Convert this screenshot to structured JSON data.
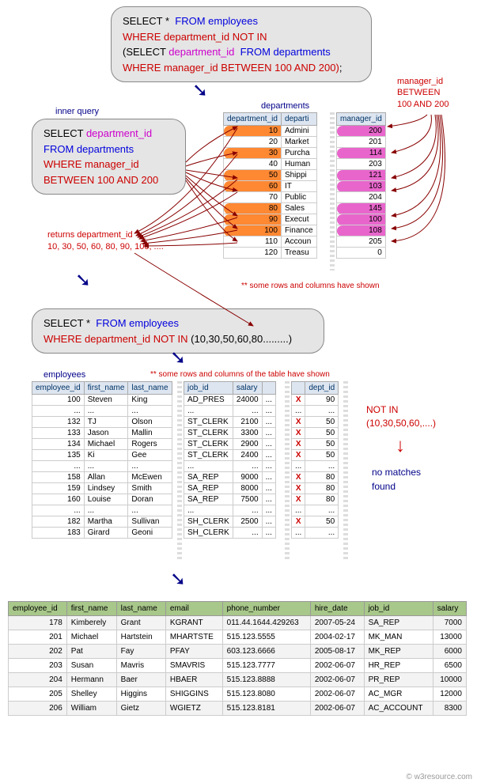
{
  "queries": {
    "main": {
      "l1a": "SELECT * ",
      "l1b": "FROM employees",
      "l2a": "WHERE department_id NOT IN",
      "l3a": "(SELECT ",
      "l3b": "department_id ",
      "l3c": "FROM departments",
      "l4a": "WHERE manager_id BETWEEN 100 AND 200)",
      "l4b": ";"
    },
    "inner": {
      "l1a": "SELECT ",
      "l1b": "department_id",
      "l2": "FROM departments",
      "l3a": "WHERE manager_id",
      "l3b": "BETWEEN 100 AND 200"
    },
    "expanded": {
      "l1a": "SELECT * ",
      "l1b": "FROM employees",
      "l2a": "WHERE department_id NOT IN ",
      "l2b": "(10,30,50,60,80.........)"
    }
  },
  "labels": {
    "inner_query": "inner query",
    "departments": "departments",
    "mgr_between": "manager_id\nBETWEEN\n100 AND 200",
    "returns": "returns department_id\n10, 30, 50, 60, 80, 90, 100, ....",
    "note1": "** some rows and columns have shown",
    "employees": "employees",
    "note2": "** some rows and columns of the table have shown",
    "notin": "NOT IN\n(10,30,50,60,....)",
    "nomatch": "no matches\nfound",
    "footer": "© w3resource.com"
  },
  "dept_table": {
    "headers": [
      "department_id",
      "departi",
      "manager_id"
    ],
    "rows": [
      {
        "id": "10",
        "name": "Admini",
        "mgr": "200",
        "hl": true
      },
      {
        "id": "20",
        "name": "Market",
        "mgr": "201",
        "hl": false
      },
      {
        "id": "30",
        "name": "Purcha",
        "mgr": "114",
        "hl": true
      },
      {
        "id": "40",
        "name": "Human",
        "mgr": "203",
        "hl": false
      },
      {
        "id": "50",
        "name": "Shippi",
        "mgr": "121",
        "hl": true
      },
      {
        "id": "60",
        "name": "IT",
        "mgr": "103",
        "hl": true
      },
      {
        "id": "70",
        "name": "Public",
        "mgr": "204",
        "hl": false
      },
      {
        "id": "80",
        "name": "Sales",
        "mgr": "145",
        "hl": true
      },
      {
        "id": "90",
        "name": "Execut",
        "mgr": "100",
        "hl": true
      },
      {
        "id": "100",
        "name": "Finance",
        "mgr": "108",
        "hl": true
      },
      {
        "id": "110",
        "name": "Accoun",
        "mgr": "205",
        "hl": false
      },
      {
        "id": "120",
        "name": "Treasu",
        "mgr": "0",
        "hl": false
      }
    ]
  },
  "emp_table": {
    "headers": [
      "employee_id",
      "first_name",
      "last_name",
      "job_id",
      "salary",
      "",
      "dept_id"
    ],
    "rows": [
      {
        "id": "100",
        "fn": "Steven",
        "ln": "King",
        "job": "AD_PRES",
        "sal": "24000",
        "d": "90"
      },
      {
        "id": "...",
        "fn": "...",
        "ln": "...",
        "job": "...",
        "sal": "...",
        "d": "..."
      },
      {
        "id": "132",
        "fn": "TJ",
        "ln": "Olson",
        "job": "ST_CLERK",
        "sal": "2100",
        "d": "50"
      },
      {
        "id": "133",
        "fn": "Jason",
        "ln": "Mallin",
        "job": "ST_CLERK",
        "sal": "3300",
        "d": "50"
      },
      {
        "id": "134",
        "fn": "Michael",
        "ln": "Rogers",
        "job": "ST_CLERK",
        "sal": "2900",
        "d": "50"
      },
      {
        "id": "135",
        "fn": "Ki",
        "ln": "Gee",
        "job": "ST_CLERK",
        "sal": "2400",
        "d": "50"
      },
      {
        "id": "...",
        "fn": "...",
        "ln": "...",
        "job": "...",
        "sal": "...",
        "d": "..."
      },
      {
        "id": "158",
        "fn": "Allan",
        "ln": "McEwen",
        "job": "SA_REP",
        "sal": "9000",
        "d": "80"
      },
      {
        "id": "159",
        "fn": "Lindsey",
        "ln": "Smith",
        "job": "SA_REP",
        "sal": "8000",
        "d": "80"
      },
      {
        "id": "160",
        "fn": "Louise",
        "ln": "Doran",
        "job": "SA_REP",
        "sal": "7500",
        "d": "80"
      },
      {
        "id": "...",
        "fn": "...",
        "ln": "...",
        "job": "...",
        "sal": "...",
        "d": "..."
      },
      {
        "id": "182",
        "fn": "Martha",
        "ln": "Sullivan",
        "job": "SH_CLERK",
        "sal": "2500",
        "d": "50"
      },
      {
        "id": "183",
        "fn": "Girard",
        "ln": "Geoni",
        "job": "SH_CLERK",
        "sal": "...",
        "d": "..."
      }
    ]
  },
  "result_table": {
    "headers": [
      "employee_id",
      "first_name",
      "last_name",
      "email",
      "phone_number",
      "hire_date",
      "job_id",
      "salary"
    ],
    "rows": [
      {
        "id": "178",
        "fn": "Kimberely",
        "ln": "Grant",
        "em": "KGRANT",
        "ph": "011.44.1644.429263",
        "hd": "2007-05-24",
        "job": "SA_REP",
        "sal": "7000"
      },
      {
        "id": "201",
        "fn": "Michael",
        "ln": "Hartstein",
        "em": "MHARTSTE",
        "ph": "515.123.5555",
        "hd": "2004-02-17",
        "job": "MK_MAN",
        "sal": "13000"
      },
      {
        "id": "202",
        "fn": "Pat",
        "ln": "Fay",
        "em": "PFAY",
        "ph": "603.123.6666",
        "hd": "2005-08-17",
        "job": "MK_REP",
        "sal": "6000"
      },
      {
        "id": "203",
        "fn": "Susan",
        "ln": "Mavris",
        "em": "SMAVRIS",
        "ph": "515.123.7777",
        "hd": "2002-06-07",
        "job": "HR_REP",
        "sal": "6500"
      },
      {
        "id": "204",
        "fn": "Hermann",
        "ln": "Baer",
        "em": "HBAER",
        "ph": "515.123.8888",
        "hd": "2002-06-07",
        "job": "PR_REP",
        "sal": "10000"
      },
      {
        "id": "205",
        "fn": "Shelley",
        "ln": "Higgins",
        "em": "SHIGGINS",
        "ph": "515.123.8080",
        "hd": "2002-06-07",
        "job": "AC_MGR",
        "sal": "12000"
      },
      {
        "id": "206",
        "fn": "William",
        "ln": "Gietz",
        "em": "WGIETZ",
        "ph": "515.123.8181",
        "hd": "2002-06-07",
        "job": "AC_ACCOUNT",
        "sal": "8300"
      }
    ]
  }
}
